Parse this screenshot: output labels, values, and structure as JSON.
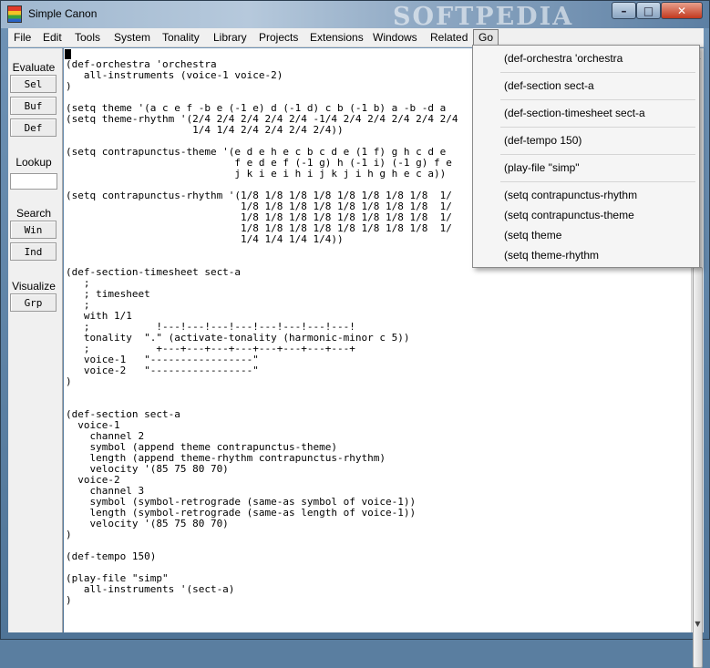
{
  "window": {
    "title": "Simple Canon",
    "watermark": "SOFTPEDIA"
  },
  "menu": [
    "File",
    "Edit",
    "Tools",
    "System",
    "Tonality",
    "Library",
    "Projects",
    "Extensions",
    "Windows",
    "Related",
    "Go"
  ],
  "sidebar": {
    "evaluate_label": "Evaluate",
    "sel": "Sel",
    "buf": "Buf",
    "def": "Def",
    "lookup_label": "Lookup",
    "lookup_value": "",
    "search_label": "Search",
    "win": "Win",
    "ind": "Ind",
    "visualize_label": "Visualize",
    "grp": "Grp"
  },
  "dropdown": [
    "(def-orchestra  'orchestra",
    "(def-section  sect-a",
    "(def-section-timesheet  sect-a",
    "(def-tempo 150)",
    "(play-file  \"simp\"",
    "(setq contrapunctus-rhythm",
    "(setq contrapunctus-theme",
    "(setq theme",
    "(setq theme-rhythm"
  ],
  "code": "\n(def-orchestra 'orchestra\n   all-instruments (voice-1 voice-2)\n)\n\n(setq theme '(a c e f -b e (-1 e) d (-1 d) c b (-1 b) a -b -d a\n(setq theme-rhythm '(2/4 2/4 2/4 2/4 2/4 -1/4 2/4 2/4 2/4 2/4 2/4\n                     1/4 1/4 2/4 2/4 2/4 2/4))\n\n(setq contrapunctus-theme '(e d e h e c b c d e (1 f) g h c d e\n                            f e d e f (-1 g) h (-1 i) (-1 g) f e\n                            j k i e i h i j k j i h g h e c a))\n\n(setq contrapunctus-rhythm '(1/8 1/8 1/8 1/8 1/8 1/8 1/8 1/8  1/\n                             1/8 1/8 1/8 1/8 1/8 1/8 1/8 1/8  1/\n                             1/8 1/8 1/8 1/8 1/8 1/8 1/8 1/8  1/\n                             1/8 1/8 1/8 1/8 1/8 1/8 1/8 1/8  1/\n                             1/4 1/4 1/4 1/4))\n\n\n(def-section-timesheet sect-a\n   ;\n   ; timesheet\n   ;\n   with 1/1\n   ;           !---!---!---!---!---!---!---!---!\n   tonality  \".\" (activate-tonality (harmonic-minor c 5))\n   ;           +---+---+---+---+---+---+---+---+\n   voice-1   \"-----------------\"\n   voice-2   \"-----------------\"\n)\n\n\n(def-section sect-a\n  voice-1\n    channel 2\n    symbol (append theme contrapunctus-theme)\n    length (append theme-rhythm contrapunctus-rhythm)\n    velocity '(85 75 80 70)\n  voice-2\n    channel 3\n    symbol (symbol-retrograde (same-as symbol of voice-1))\n    length (symbol-retrograde (same-as length of voice-1))\n    velocity '(85 75 80 70)\n)\n\n(def-tempo 150)\n\n(play-file \"simp\"\n   all-instruments '(sect-a)\n)"
}
